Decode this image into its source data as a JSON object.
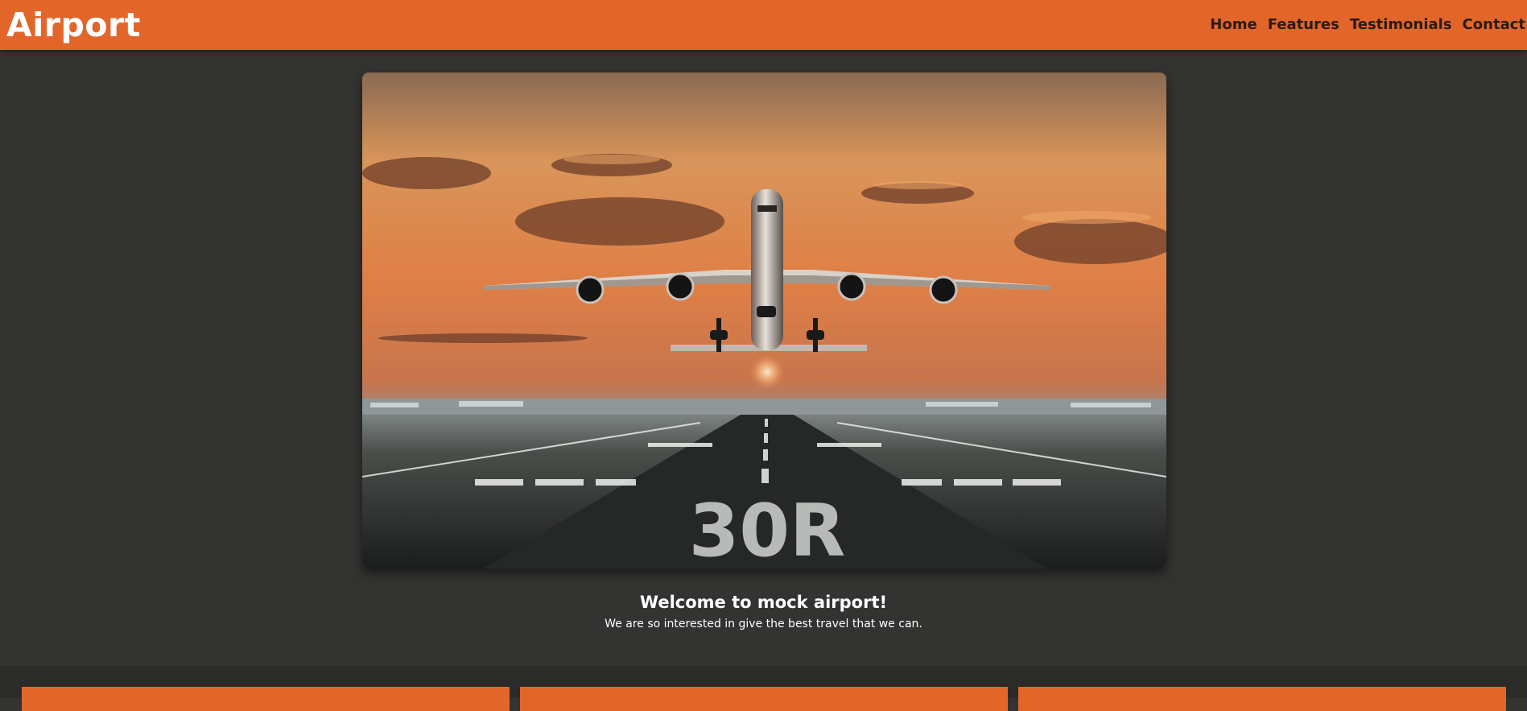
{
  "header": {
    "logo": "Airport",
    "nav": {
      "home": "Home",
      "features": "Features",
      "testimonials": "Testimonials",
      "contact": "Contact"
    }
  },
  "hero": {
    "image": "airplane-takeoff-runway-sunset-photo",
    "runway_marking": "30R"
  },
  "main": {
    "title": "Welcome to mock airport!",
    "subtitle": "We are so interested in give the best travel that we can."
  },
  "colors": {
    "accent": "#e2662a",
    "background": "#333331",
    "nav_text": "#2a1a12",
    "text": "#ffffff"
  }
}
